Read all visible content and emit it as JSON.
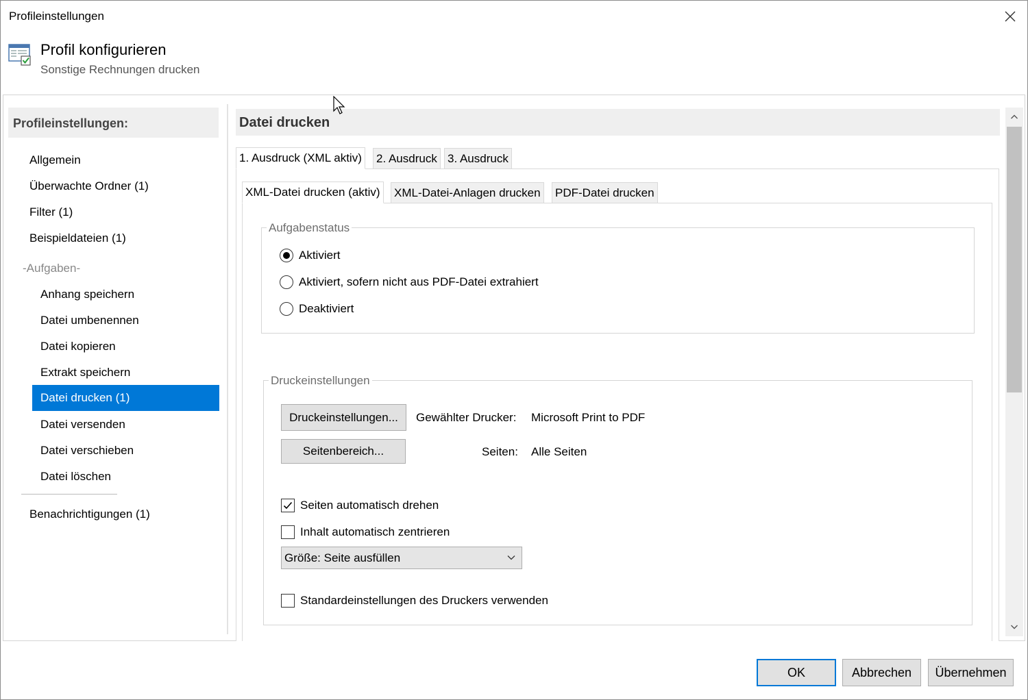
{
  "window": {
    "title": "Profileinstellungen"
  },
  "header": {
    "title": "Profil konfigurieren",
    "subtitle": "Sonstige Rechnungen drucken",
    "icon": "settings-window-icon"
  },
  "sidebar": {
    "heading": "Profileinstellungen:",
    "items": [
      "Allgemein",
      "Überwachte Ordner (1)",
      "Filter (1)",
      "Beispieldateien (1)"
    ],
    "section_label": "-Aufgaben-",
    "tasks": [
      "Anhang speichern",
      "Datei umbenennen",
      "Datei kopieren",
      "Extrakt speichern",
      "Datei drucken (1)",
      "Datei versenden",
      "Datei verschieben",
      "Datei löschen"
    ],
    "selected": "Datei drucken (1)",
    "bottom_item": "Benachrichtigungen (1)"
  },
  "main": {
    "heading": "Datei drucken",
    "outer_tabs": [
      "1. Ausdruck (XML aktiv)",
      "2. Ausdruck",
      "3. Ausdruck"
    ],
    "inner_tabs": [
      "XML-Datei drucken (aktiv)",
      "XML-Datei-Anlagen drucken",
      "PDF-Datei drucken"
    ],
    "status_group": {
      "label": "Aufgabenstatus",
      "options": [
        "Aktiviert",
        "Aktiviert, sofern nicht aus PDF-Datei extrahiert",
        "Deaktiviert"
      ],
      "selected": "Aktiviert"
    },
    "print_group": {
      "label": "Druckeinstellungen",
      "print_settings_button": "Druckeinstellungen...",
      "page_range_button": "Seitenbereich...",
      "printer_label": "Gewählter Drucker:",
      "printer_value": "Microsoft Print to PDF",
      "pages_label": "Seiten:",
      "pages_value": "Alle Seiten",
      "auto_rotate": {
        "label": "Seiten automatisch drehen",
        "checked": true
      },
      "auto_center": {
        "label": "Inhalt automatisch zentrieren",
        "checked": false
      },
      "size_select": "Größe: Seite ausfüllen",
      "use_defaults": {
        "label": "Standardeinstellungen des Druckers verwenden",
        "checked": false
      }
    }
  },
  "footer": {
    "ok": "OK",
    "cancel": "Abbrechen",
    "apply": "Übernehmen"
  },
  "colors": {
    "selection": "#0078d7",
    "panel_header": "#efefef",
    "button": "#e1e1e1"
  }
}
